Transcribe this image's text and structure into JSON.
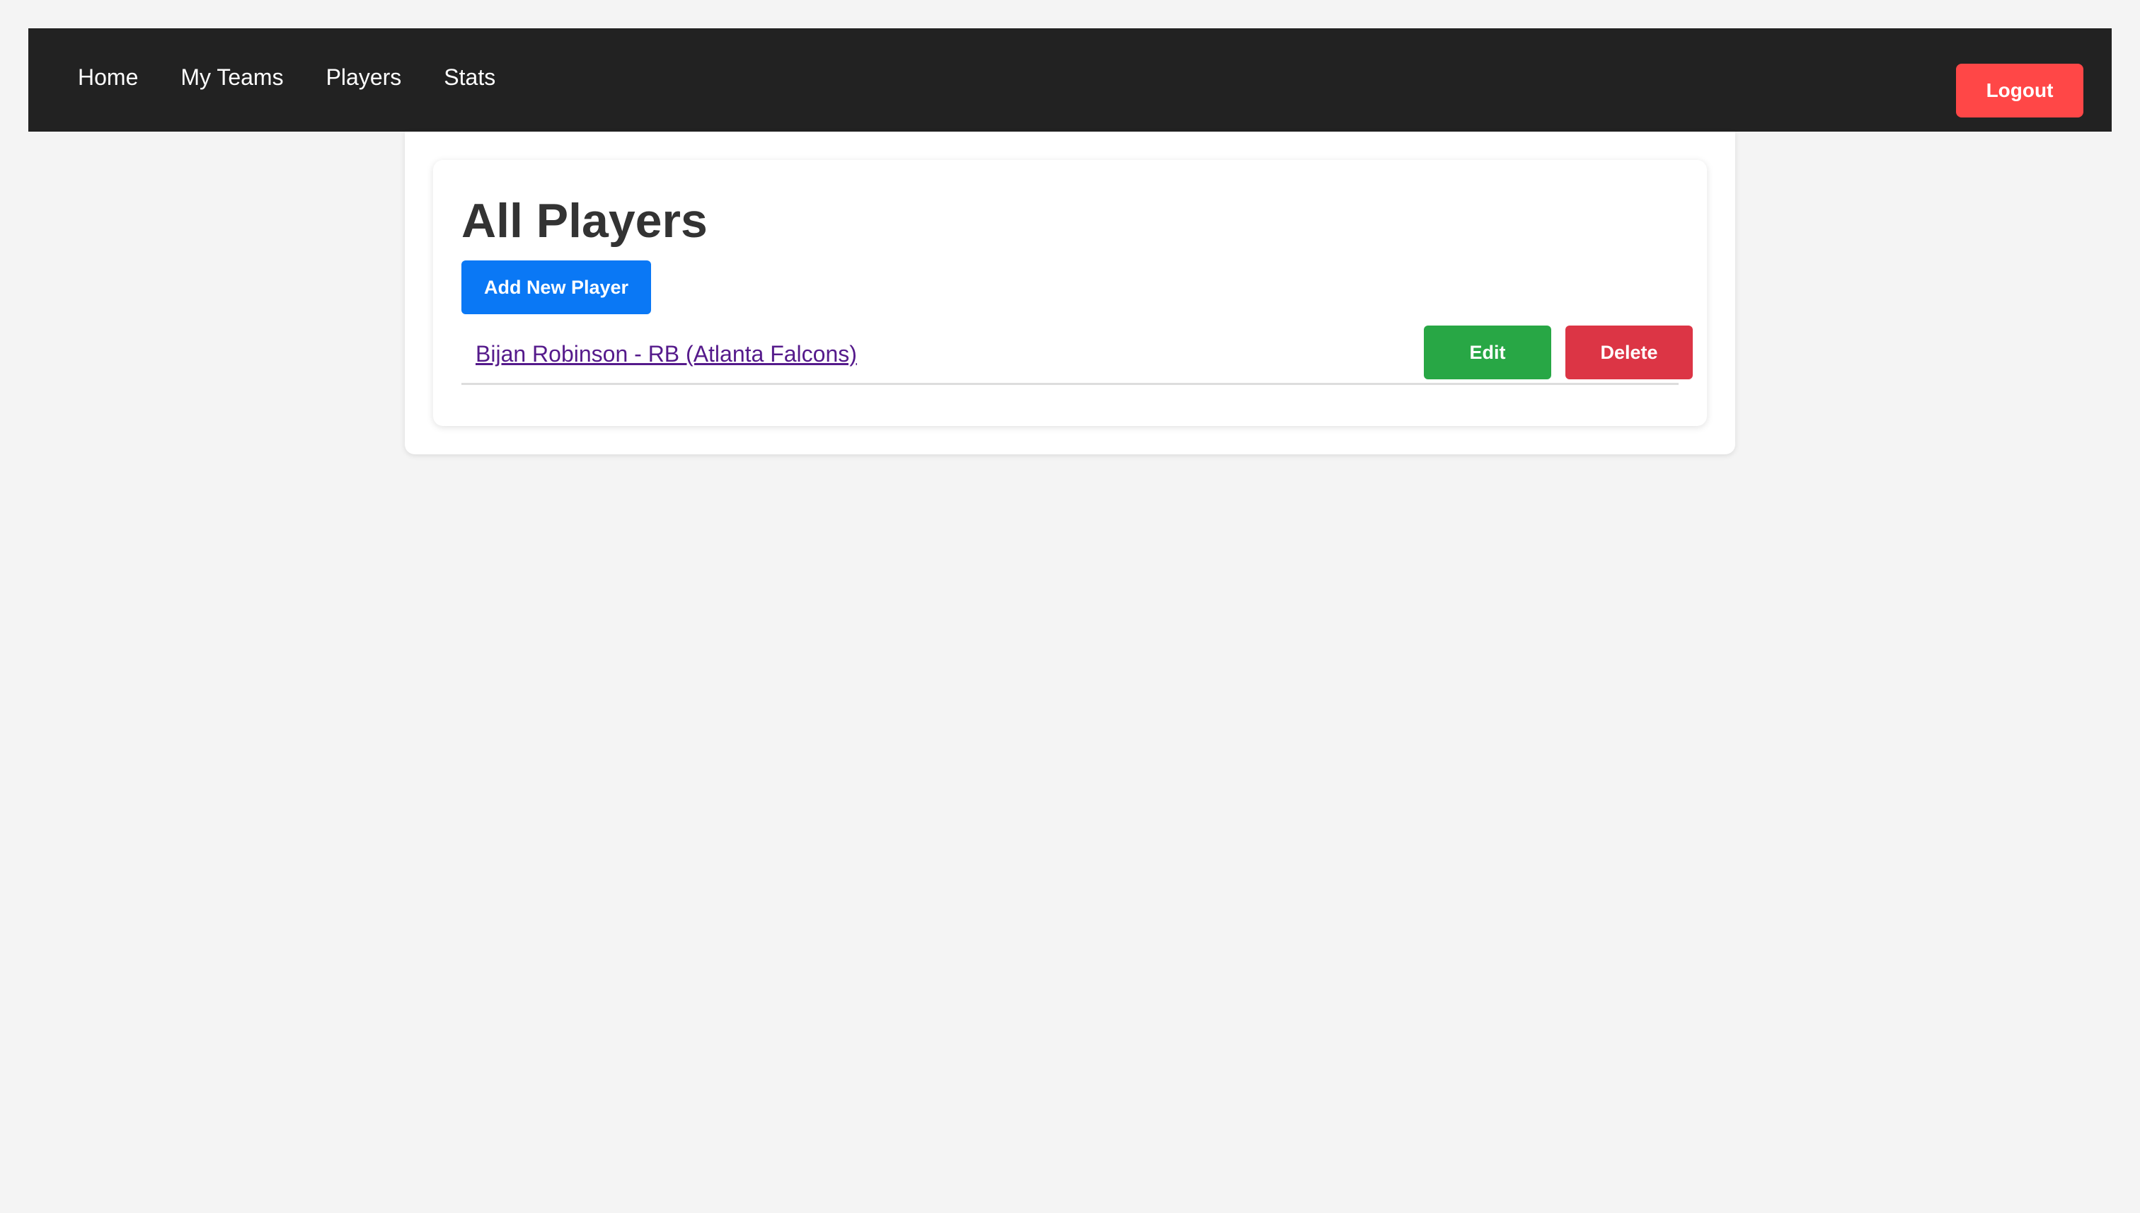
{
  "nav": {
    "items": [
      {
        "label": "Home"
      },
      {
        "label": "My Teams"
      },
      {
        "label": "Players"
      },
      {
        "label": "Stats"
      }
    ],
    "logout_label": "Logout"
  },
  "main": {
    "title": "All Players",
    "add_button_label": "Add New Player",
    "players": [
      {
        "text": "Bijan Robinson - RB (Atlanta Falcons)",
        "edit_label": "Edit",
        "delete_label": "Delete"
      }
    ]
  },
  "colors": {
    "navbar_bg": "#222222",
    "logout": "#ff4747",
    "primary": "#0a78f5",
    "edit": "#28a745",
    "delete": "#dc3545",
    "link": "#551a8b",
    "page_bg": "#f4f4f4"
  }
}
